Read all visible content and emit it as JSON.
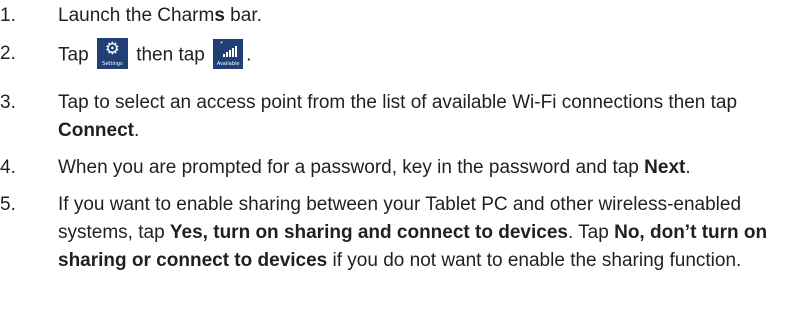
{
  "steps": [
    {
      "number": "1.",
      "before": "Launch the Charm",
      "bold": "s",
      "after": " bar."
    },
    {
      "number": "2.",
      "tap_1": "Tap",
      "settings_tile": {
        "icon": "gear-icon",
        "caption": "Settings",
        "color": "#1f3f75"
      },
      "then_tap": "then tap",
      "available_tile": {
        "icon": "wifi-signal-icon",
        "caption": "Available",
        "color": "#1f3f75"
      },
      "end": "."
    },
    {
      "number": "3.",
      "before": "Tap to select an access point from the list of available Wi-Fi connections then tap ",
      "bold": "Connect",
      "after": "."
    },
    {
      "number": "4.",
      "before": "When you are prompted for a password, key in the password and tap ",
      "bold": "Next",
      "after": "."
    },
    {
      "number": "5.",
      "part1": "If you want to enable sharing between your Tablet PC and other wireless-enabled systems, tap ",
      "bold1": "Yes, turn on sharing and connect to devices",
      "part2": ". Tap ",
      "bold2": "No, don’t turn on sharing or connect to devices",
      "part3": " if you do not want to enable the sharing function."
    }
  ]
}
